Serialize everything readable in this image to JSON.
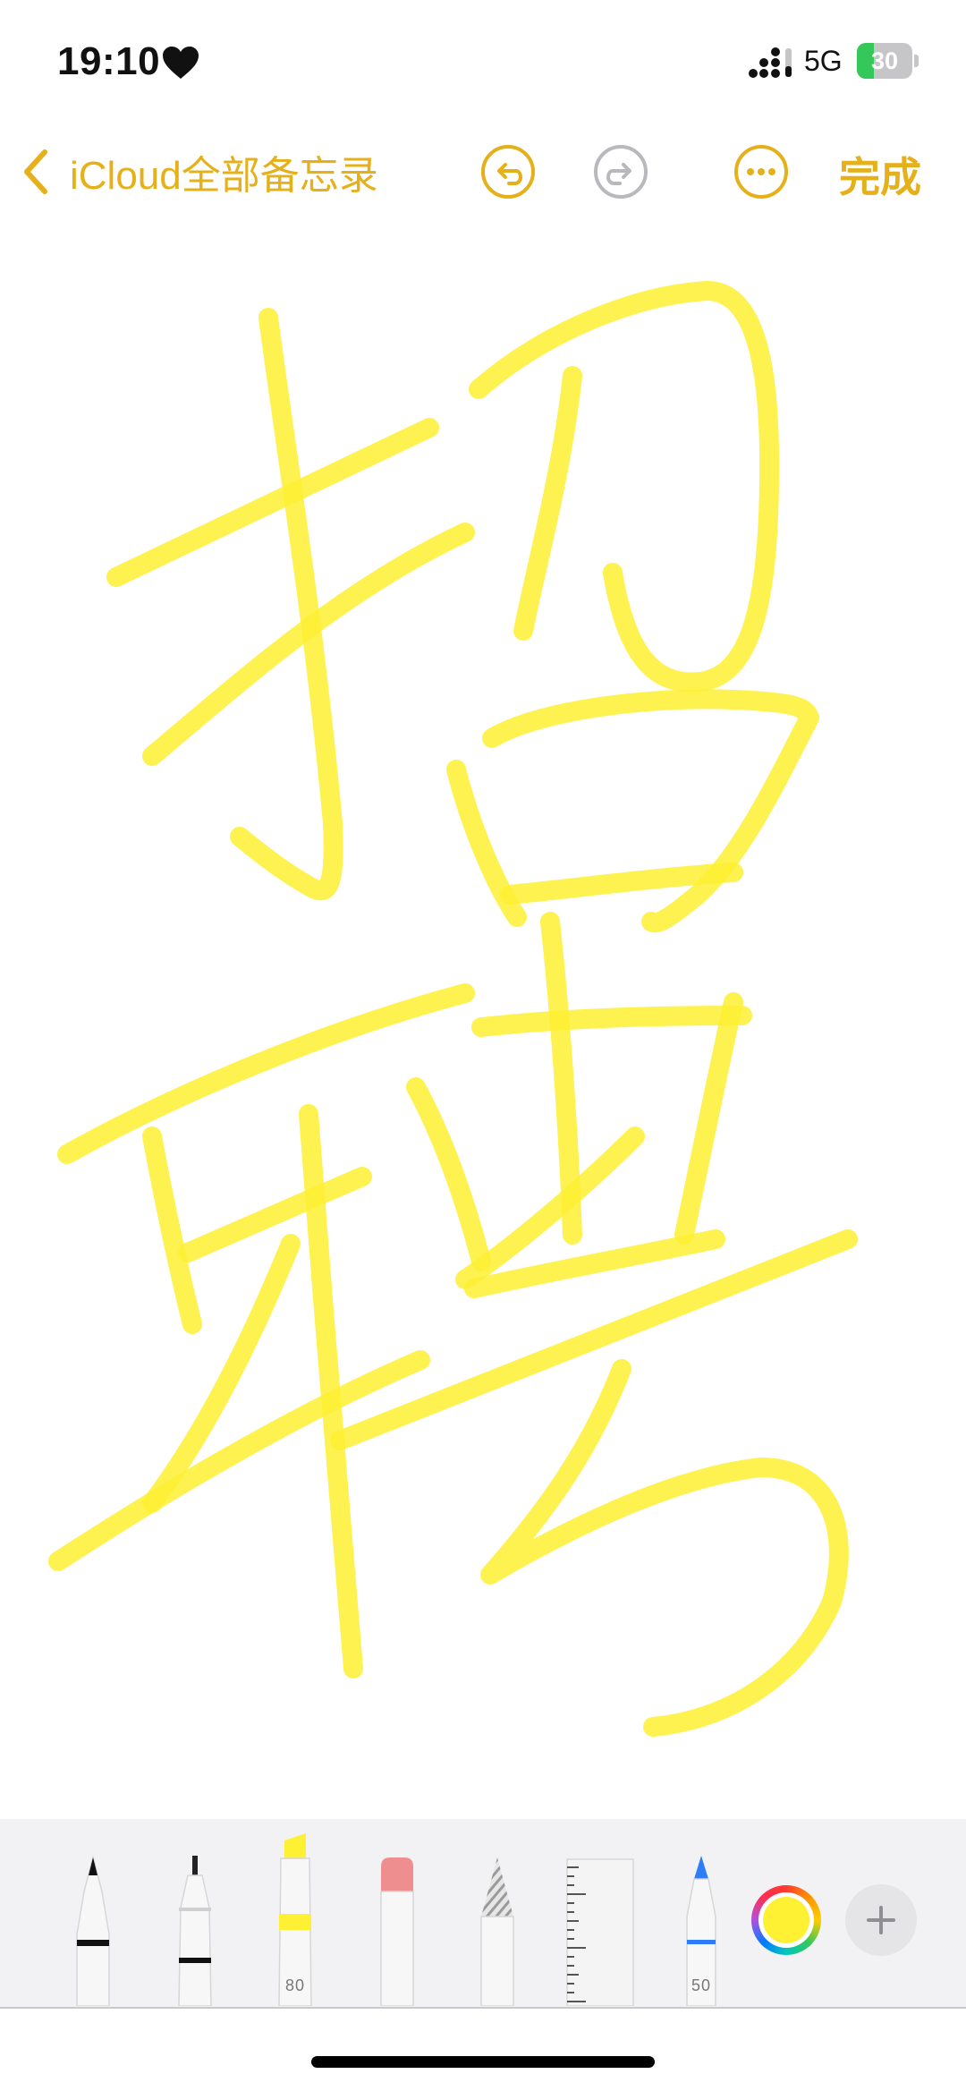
{
  "status_bar": {
    "time": "19:10",
    "network": "5G",
    "battery_level": "30",
    "battery_fraction": 0.3,
    "icons": [
      "heart-icon",
      "signal-icon",
      "battery-charging-icon"
    ]
  },
  "nav": {
    "back_label": "iCloud全部备忘录",
    "done_label": "完成",
    "icons": [
      "chevron-left-icon",
      "undo-icon",
      "redo-icon",
      "more-icon"
    ],
    "undo_enabled": true,
    "redo_enabled": false
  },
  "palette": {
    "tools": [
      {
        "name": "pen",
        "icon": "pen-tool-icon"
      },
      {
        "name": "fine-liner",
        "icon": "fineliner-tool-icon"
      },
      {
        "name": "highlighter",
        "icon": "highlighter-tool-icon",
        "value": "80",
        "selected": true
      },
      {
        "name": "eraser",
        "icon": "eraser-tool-icon"
      },
      {
        "name": "pencil",
        "icon": "pencil-tool-icon"
      },
      {
        "name": "ruler",
        "icon": "ruler-tool-icon"
      },
      {
        "name": "crayon",
        "icon": "crayon-tool-icon",
        "value": "50"
      }
    ],
    "selected_color": "#fef032",
    "add_icon": "plus-icon"
  },
  "colors": {
    "accent": "#e5b019",
    "ink": "#fef032",
    "disabled": "#b9b9bd"
  }
}
